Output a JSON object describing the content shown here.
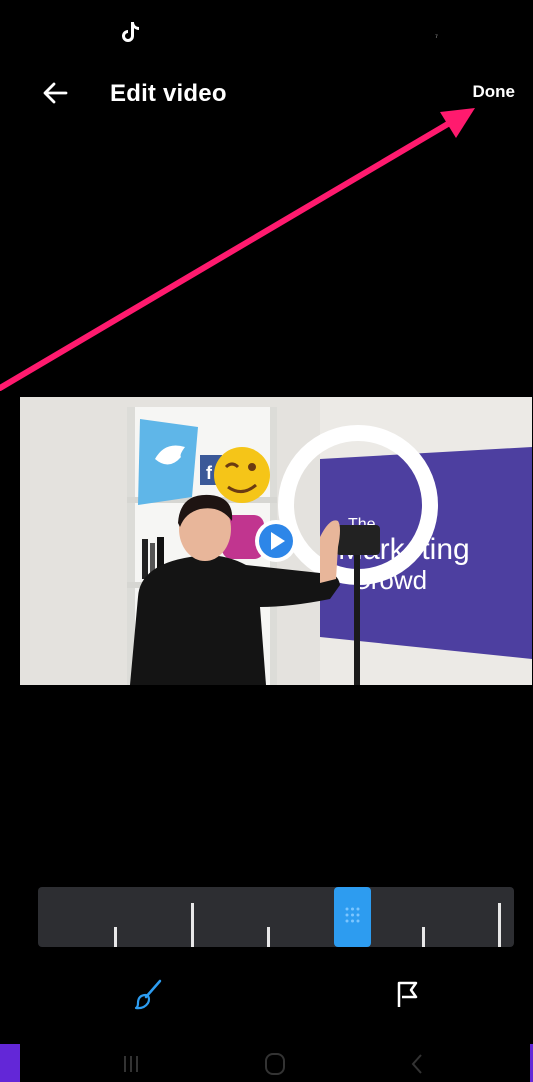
{
  "status_bar": {
    "app_icon": "tiktok-icon",
    "indicator": "⁷"
  },
  "header": {
    "back_icon": "arrow-left-icon",
    "title": "Edit video",
    "done_label": "Done"
  },
  "video": {
    "play_icon": "play-icon",
    "scene_sign_lines": [
      "The",
      "Marketing",
      "Crowd"
    ]
  },
  "timeline": {
    "handle_icon": "drag-grip-icon"
  },
  "tools": [
    {
      "name": "brush-icon"
    },
    {
      "name": "flag-icon"
    }
  ],
  "nav_bar": {
    "recents": "recent-apps-icon",
    "home": "home-icon",
    "back": "nav-back-icon"
  },
  "colors": {
    "accent": "#2d9cf0",
    "annotation_arrow": "#ff1a6e",
    "nav_accent": "#6327d7"
  }
}
